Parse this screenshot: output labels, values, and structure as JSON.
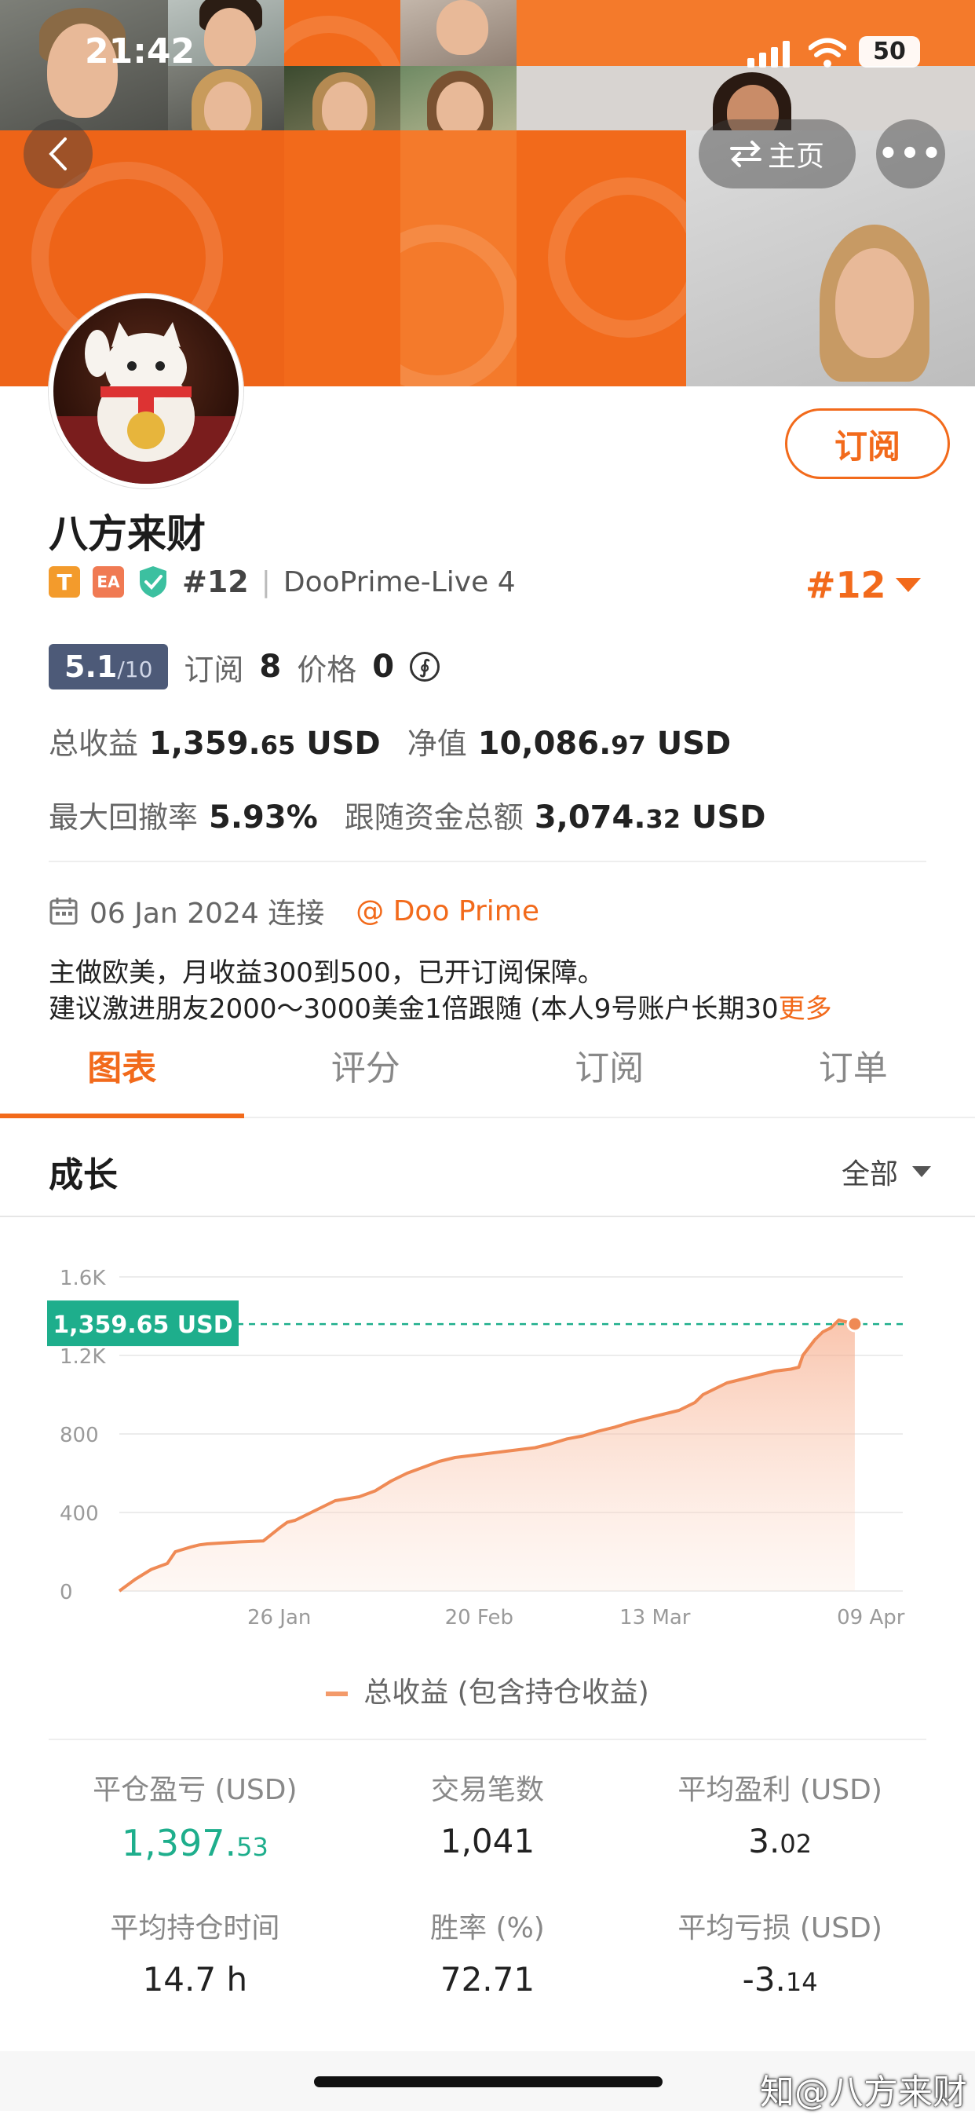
{
  "status_bar": {
    "time": "21:42",
    "battery": "50"
  },
  "nav": {
    "home_label": "主页",
    "more_label": "•••"
  },
  "profile": {
    "name": "八方来财",
    "subscribe_label": "订阅",
    "tag_t": "T",
    "tag_ea": "EA",
    "rank_small": "#12",
    "separator": "|",
    "account": "DooPrime-Live 4",
    "rank_big": "#12",
    "score": "5.1",
    "score_max": "/10",
    "subscribe_count_label": "订阅",
    "subscribe_count": "8",
    "price_label": "价格",
    "price": "0",
    "coin_symbol": "∮",
    "total_profit_label": "总收益",
    "total_profit_int": "1,359.",
    "total_profit_dec": "65",
    "total_profit_unit": "USD",
    "equity_label": "净值",
    "equity_int": "10,086.",
    "equity_dec": "97",
    "equity_unit": "USD",
    "drawdown_label": "最大回撤率",
    "drawdown": "5.93%",
    "follow_funds_label": "跟随资金总额",
    "follow_funds_int": "3,074.",
    "follow_funds_dec": "32",
    "follow_funds_unit": "USD",
    "connect_date": "06 Jan 2024 连接",
    "broker": "@ Doo Prime",
    "desc_line1": "主做欧美，月收益300到500，已开订阅保障。",
    "desc_line2": "建议激进朋友2000～3000美金1倍跟随 (本人9号账户长期30",
    "desc_more": "更多"
  },
  "tabs": [
    {
      "label": "图表",
      "active": true
    },
    {
      "label": "评分",
      "active": false
    },
    {
      "label": "订阅",
      "active": false
    },
    {
      "label": "订单",
      "active": false
    }
  ],
  "section": {
    "title": "成长",
    "filter": "全部"
  },
  "chart_data": {
    "type": "area",
    "y_ticks": [
      "0",
      "400",
      "800",
      "1.2K",
      "1.6K"
    ],
    "ylim": [
      0,
      1600
    ],
    "x_ticks": [
      {
        "label": "26 Jan",
        "x": 20
      },
      {
        "label": "20 Feb",
        "x": 45
      },
      {
        "label": "13 Mar",
        "x": 67
      },
      {
        "label": "09 Apr",
        "x": 94
      }
    ],
    "xlim": [
      0,
      98
    ],
    "current_label": "1,359.65 USD",
    "current_value": 1359.65,
    "series": [
      {
        "name": "总收益 (包含持仓收益)",
        "x": [
          0,
          2,
          4,
          6,
          7,
          9,
          10,
          11,
          13,
          15,
          18,
          20,
          21,
          22,
          24,
          26,
          27,
          30,
          32,
          34,
          36,
          38,
          40,
          42,
          44,
          46,
          48,
          50,
          52,
          54,
          56,
          58,
          60,
          62,
          64,
          66,
          68,
          70,
          72,
          73,
          74,
          76,
          78,
          80,
          82,
          84,
          85,
          85.5,
          87,
          88,
          89,
          90,
          92
        ],
        "y": [
          0,
          60,
          110,
          140,
          200,
          225,
          235,
          240,
          245,
          250,
          255,
          320,
          350,
          360,
          400,
          440,
          460,
          480,
          510,
          560,
          600,
          630,
          660,
          680,
          690,
          700,
          710,
          720,
          730,
          750,
          775,
          790,
          815,
          835,
          860,
          880,
          900,
          920,
          960,
          1000,
          1020,
          1060,
          1080,
          1100,
          1120,
          1130,
          1140,
          1200,
          1280,
          1320,
          1340,
          1380,
          1360
        ]
      }
    ],
    "legend": "总收益 (包含持仓收益)"
  },
  "stats": [
    {
      "label": "平仓盈亏 (USD)",
      "int": "1,397.",
      "dec": "53",
      "green": true
    },
    {
      "label": "交易笔数",
      "int": "1,041",
      "dec": "",
      "green": false
    },
    {
      "label": "平均盈利 (USD)",
      "int": "3.",
      "dec": "02",
      "green": false
    },
    {
      "label": "平均持仓时间",
      "int": "14.7 h",
      "dec": "",
      "green": false
    },
    {
      "label": "胜率 (%)",
      "int": "72.71",
      "dec": "",
      "green": false
    },
    {
      "label": "平均亏损 (USD)",
      "int": "-3.",
      "dec": "14",
      "green": false
    }
  ],
  "watermark": "知@八方来财",
  "colors": {
    "accent": "#f26a1b",
    "green": "#1eae8c",
    "score_bg": "#4d5a78"
  }
}
